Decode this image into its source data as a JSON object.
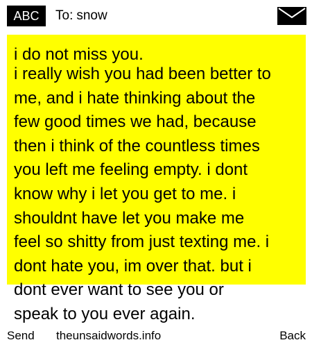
{
  "header": {
    "badge_label": "ABC",
    "to_label": "To:",
    "recipient": "snow",
    "envelope_icon": "envelope-icon"
  },
  "message": {
    "first_line": "i do not miss you.",
    "lines": [
      "i really wish you had been better to",
      "me, and i hate thinking about the",
      "few good times we had, because",
      "then i think of the countless times",
      "you left me feeling empty. i dont",
      "know why i let you get to me. i",
      "shouldnt have let you make me",
      "feel so shitty from just texting me. i",
      "dont hate you, im over that. but i",
      "dont ever want to see you or",
      "speak to you ever again."
    ]
  },
  "footer": {
    "send_label": "Send",
    "site_label": "theunsaidwords.info",
    "back_label": "Back"
  },
  "colors": {
    "message_background": "#ffff00",
    "badge_background": "#000000",
    "badge_text": "#ffffff",
    "text": "#000000"
  }
}
